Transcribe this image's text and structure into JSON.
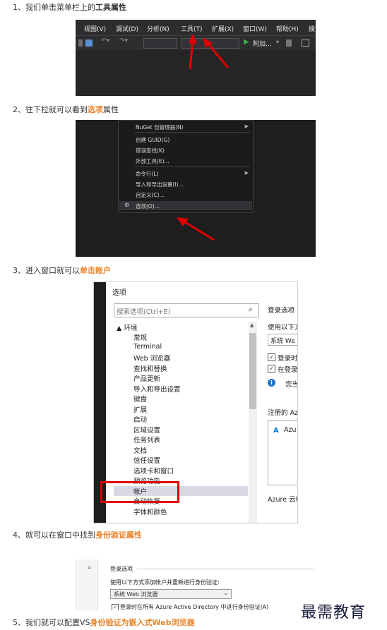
{
  "steps": [
    {
      "num": "1、",
      "pre": "我们单击菜单栏上的",
      "hl": "",
      "post": "工具属性",
      "post_bold": true
    },
    {
      "num": "2、",
      "pre": "往下拉就可以看到",
      "hl": "选项",
      "post": "属性",
      "post_bold": false
    },
    {
      "num": "3、",
      "pre": "进入窗口就可以",
      "hl": "单击账户",
      "post": "",
      "post_bold": false
    },
    {
      "num": "4、",
      "pre": "就可以在窗口中找到",
      "hl": "身份验证属性",
      "post": "",
      "post_bold": false
    },
    {
      "num": "5、",
      "pre": "我们就可以配置VS",
      "hl": "身份验证为嵌入式Web浏览器",
      "post": "",
      "post_bold": false
    }
  ],
  "shot1": {
    "menus": [
      "视图(V)",
      "调试(D)",
      "分析(N)",
      "工具(T)",
      "扩展(X)",
      "窗口(W)",
      "帮助(H)",
      "搜"
    ],
    "toolbar_attach": "附加..."
  },
  "shot2": {
    "items": [
      {
        "label": "NuGet 包管理器(N)",
        "submenu": true
      },
      {
        "label": "创建 GUID(G)",
        "submenu": false
      },
      {
        "label": "错误查找(K)",
        "submenu": false
      },
      {
        "label": "外部工具(E)...",
        "submenu": false
      },
      {
        "label": "命令行(L)",
        "submenu": true
      },
      {
        "label": "导入和导出设置(I)...",
        "submenu": false
      },
      {
        "label": "自定义(C)...",
        "submenu": false
      },
      {
        "label": "选项(O)...",
        "submenu": false
      }
    ]
  },
  "shot3": {
    "title": "选项",
    "search_placeholder": "搜索选项(Ctrl+E)",
    "tree_root": "▲ 环境",
    "tree_items": [
      "常规",
      "Terminal",
      "Web 浏览器",
      "查找和替换",
      "产品更新",
      "导入和导出设置",
      "键盘",
      "扩展",
      "启动",
      "区域设置",
      "任务列表",
      "文档",
      "信任设置",
      "选项卡和窗口",
      "预览功能",
      "帐户",
      "自动恢复",
      "字体和颜色"
    ],
    "selected_item": "帐户",
    "right": {
      "heading": "登录选项",
      "use_text": "使用以下方",
      "combo": "系统 We",
      "cb1": "登录时",
      "cb2": "在登录",
      "info": "您当",
      "registered": "注册的 Az",
      "azure_item": "Azu",
      "azure_cloud": "Azure 云标"
    }
  },
  "shot4": {
    "heading": "登录选项",
    "desc": "使用以下方式添加帐户并重新进行身份验证:",
    "combo": "系统 Web 浏览器",
    "checkbox": "登录时在所有 Azure Active Directory 中进行身份验证(A)"
  },
  "watermark": "最需教育",
  "colors": {
    "highlight": "#e8832a",
    "vs_dark": "#2d2d30",
    "red_arrow": "#e00000"
  }
}
